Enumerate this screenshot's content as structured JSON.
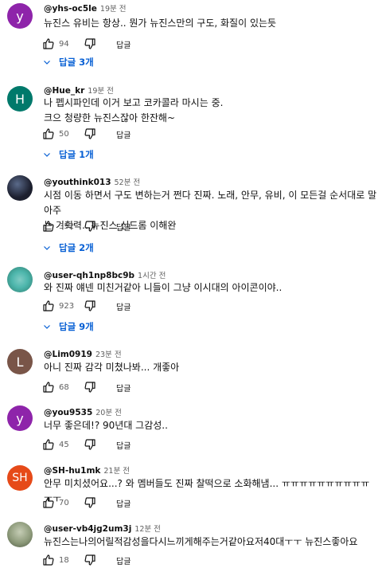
{
  "colors": {
    "link": "#065fd4",
    "secondary": "#606060"
  },
  "comments": [
    {
      "avatar_letter": "y",
      "avatar_color": "#8e24aa",
      "handle": "@yhs-oc5le",
      "time": "19분 전",
      "text": [
        "뉴진스 유비는 항상.. 뭔가 뉴진스만의 구도, 화질이 있는듯"
      ],
      "likes": "94",
      "reply_label": "답글",
      "replies": "답글 3개"
    },
    {
      "avatar_letter": "H",
      "avatar_color": "#00796b",
      "handle": "@Hue_kr",
      "time": "19분 전",
      "text": [
        "나 펩시파인데 이거 보고 코카콜라 마시는 중.",
        "크으 청량한 뉴진스잖아 한잔해~"
      ],
      "likes": "50",
      "reply_label": "답글",
      "replies": "답글 1개"
    },
    {
      "avatar_letter": "",
      "avatar_color": "#1c1f2e",
      "handle": "@youthink013",
      "time": "52분 전",
      "text": [
        "시점 이동 하면서 구도 변하는거 쩐다 진짜. 노래, 안무, 유비, 이 모든걸 순서대로 말아주",
        "는 기획력.. 뉴진스 신드롬 이해완"
      ],
      "likes": "352",
      "reply_label": "답글",
      "replies": "답글 2개"
    },
    {
      "avatar_letter": "",
      "avatar_color": "#4db6ac",
      "handle": "@user-qh1np8bc9b",
      "time": "1시간 전",
      "text": [
        "와 진짜 얘넨 미친거같아 니들이 그냥 이시대의 아이콘이야.."
      ],
      "likes": "923",
      "reply_label": "답글",
      "replies": "답글 9개"
    },
    {
      "avatar_letter": "L",
      "avatar_color": "#795548",
      "handle": "@Lim0919",
      "time": "23분 전",
      "text": [
        "아니 진짜 감각 미쳤나봐... 개좋아"
      ],
      "likes": "68",
      "reply_label": "답글"
    },
    {
      "avatar_letter": "y",
      "avatar_color": "#8e24aa",
      "handle": "@you9535",
      "time": "20분 전",
      "text": [
        "너무 좋은데!? 90년대 그감성.."
      ],
      "likes": "45",
      "reply_label": "답글"
    },
    {
      "avatar_letter": "SH",
      "avatar_color": "#e64a19",
      "handle": "@SH-hu1mk",
      "time": "21분 전",
      "text": [
        "안무 미치셨어요...? 와 멤버들도 진짜 찰떡으로 소화해냄... ㅠㅠㅠㅠㅠㅠㅠㅠㅠㅠㅜㅜ"
      ],
      "likes": "70",
      "reply_label": "답글"
    },
    {
      "avatar_letter": "",
      "avatar_color": "#8d9a7a",
      "handle": "@user-vb4jg2um3j",
      "time": "12분 전",
      "text": [
        "뉴진스는나의어릴적감성을다시느끼게해주는거같아요저40대ㅜㅜ 뉴진스좋아요"
      ],
      "likes": "18",
      "reply_label": "답글"
    }
  ]
}
